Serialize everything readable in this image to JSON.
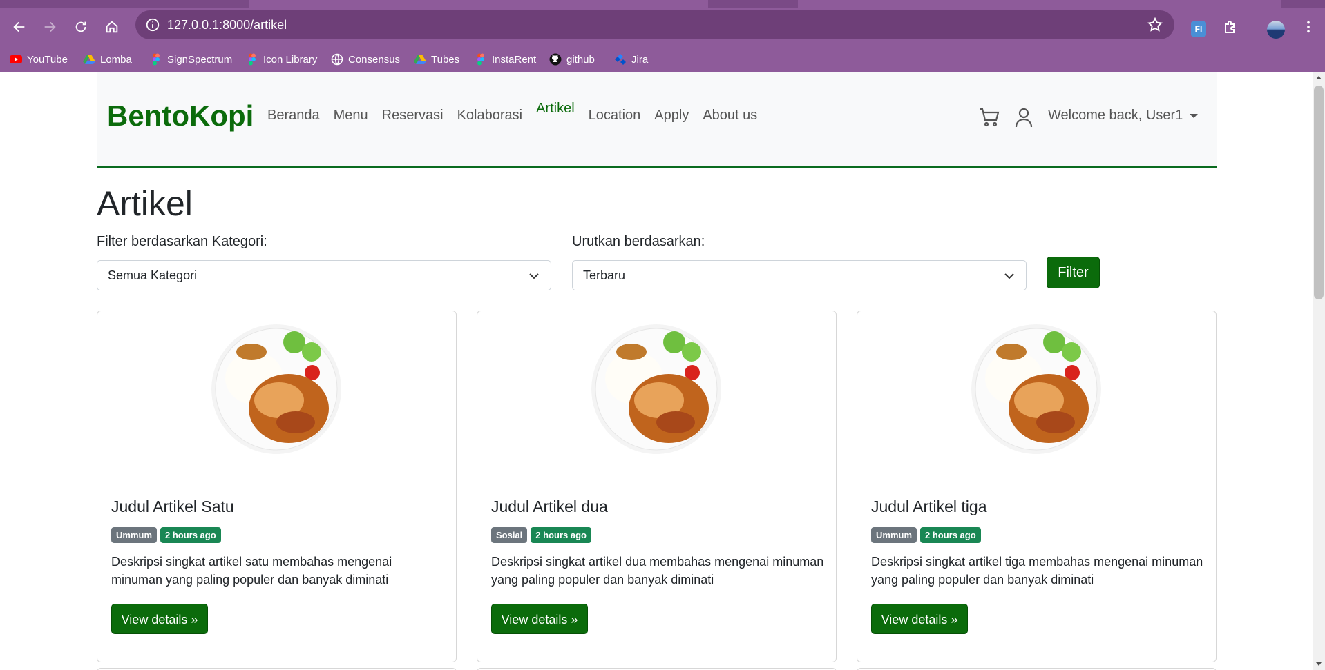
{
  "browser": {
    "url": "127.0.0.1:8000/artikel",
    "extension_label": "FI",
    "bookmarks": [
      {
        "label": "YouTube",
        "icon": "youtube-icon",
        "color": "#ff0000"
      },
      {
        "label": "Lomba",
        "icon": "google-drive-icon",
        "color": "#34a853"
      },
      {
        "label": "SignSpectrum",
        "icon": "figma-icon",
        "color": "#f24e1e"
      },
      {
        "label": "Icon Library",
        "icon": "figma-icon",
        "color": "#f24e1e"
      },
      {
        "label": "Consensus",
        "icon": "globe-icon",
        "color": "#ffffff"
      },
      {
        "label": "Tubes",
        "icon": "google-drive-icon",
        "color": "#34a853"
      },
      {
        "label": "InstaRent",
        "icon": "figma-icon",
        "color": "#f24e1e"
      },
      {
        "label": "github",
        "icon": "github-icon",
        "color": "#000000"
      },
      {
        "label": "Jira",
        "icon": "jira-icon",
        "color": "#2684ff"
      }
    ]
  },
  "navbar": {
    "brand": "BentoKopi",
    "links": [
      "Beranda",
      "Menu",
      "Reservasi",
      "Kolaborasi",
      "Artikel",
      "Location",
      "Apply",
      "About us"
    ],
    "active": "Artikel",
    "welcome": "Welcome back, User1"
  },
  "page": {
    "title": "Artikel",
    "filter_label": "Filter berdasarkan Kategori:",
    "filter_value": "Semua Kategori",
    "sort_label": "Urutkan berdasarkan:",
    "sort_value": "Terbaru",
    "filter_button": "Filter"
  },
  "articles": [
    {
      "title": "Judul Artikel Satu",
      "category": "Ummum",
      "time": "2 hours ago",
      "description": "Deskripsi singkat artikel satu membahas mengenai minuman yang paling populer dan banyak diminati",
      "button": "View details »"
    },
    {
      "title": "Judul Artikel dua",
      "category": "Sosial",
      "time": "2 hours ago",
      "description": "Deskripsi singkat artikel dua membahas mengenai minuman yang paling populer dan banyak diminati",
      "button": "View details »"
    },
    {
      "title": "Judul Artikel tiga",
      "category": "Ummum",
      "time": "2 hours ago",
      "description": "Deskripsi singkat artikel tiga membahas mengenai minuman yang paling populer dan banyak diminati",
      "button": "View details »"
    }
  ],
  "colors": {
    "brand_green": "#0b6b0b",
    "badge_gray": "#6c757d",
    "badge_green": "#198754",
    "chrome_purple": "#8e5b9a"
  }
}
